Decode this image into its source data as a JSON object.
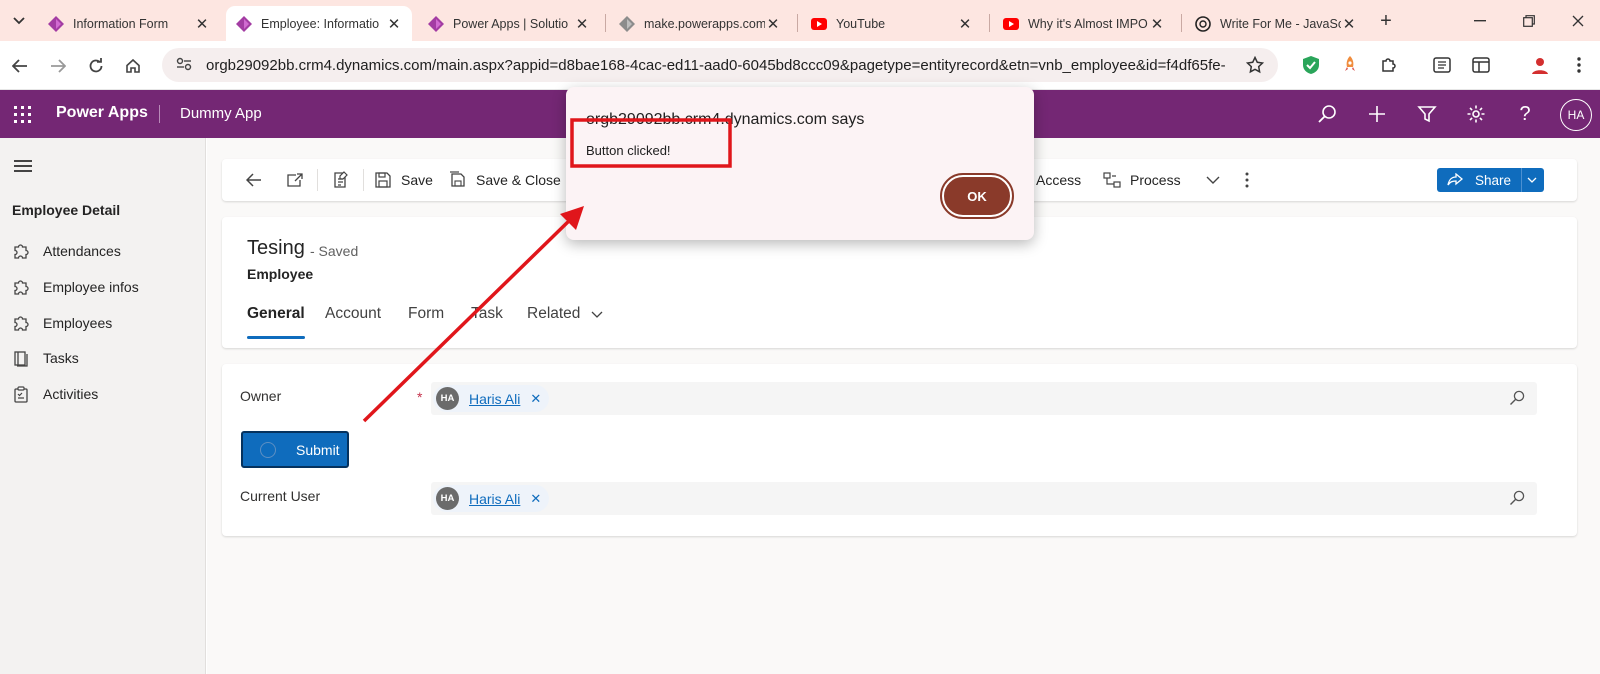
{
  "browser": {
    "tabs": [
      {
        "title": "Information Form",
        "icon": "power-apps-icon",
        "active": false
      },
      {
        "title": "Employee: Informatio",
        "icon": "power-apps-icon",
        "active": true
      },
      {
        "title": "Power Apps | Solutio",
        "icon": "power-apps-icon",
        "active": false
      },
      {
        "title": "make.powerapps.com",
        "icon": "power-apps-gray-icon",
        "active": false
      },
      {
        "title": "YouTube",
        "icon": "youtube-icon",
        "active": false
      },
      {
        "title": "Why it's Almost IMPO",
        "icon": "youtube-icon",
        "active": false
      },
      {
        "title": "Write For Me - JavaSc",
        "icon": "openai-icon",
        "active": false
      }
    ],
    "url": "orgb29092bb.crm4.dynamics.com/main.aspx?appid=d8bae168-4cac-ed11-aad0-6045bd8ccc09&pagetype=entityrecord&etn=vnb_employee&id=f4df65fe-9ef..."
  },
  "app": {
    "brand": "Power Apps",
    "name": "Dummy App",
    "user_initials": "HA"
  },
  "sidebar": {
    "heading": "Employee Detail",
    "items": [
      {
        "label": "Attendances",
        "icon": "puzzle-icon"
      },
      {
        "label": "Employee infos",
        "icon": "puzzle-icon"
      },
      {
        "label": "Employees",
        "icon": "puzzle-icon"
      },
      {
        "label": "Tasks",
        "icon": "task-icon"
      },
      {
        "label": "Activities",
        "icon": "clipboard-icon"
      }
    ]
  },
  "commandbar": {
    "save": "Save",
    "save_close": "Save & Close",
    "access": "Access",
    "process": "Process",
    "share": "Share"
  },
  "record": {
    "title": "Tesing",
    "status": "- Saved",
    "entity": "Employee",
    "tabs": [
      "General",
      "Account",
      "Form",
      "Task",
      "Related"
    ]
  },
  "form": {
    "owner_label": "Owner",
    "owner_required": "*",
    "owner_value": "Haris Ali",
    "owner_initials": "HA",
    "submit_label": "Submit",
    "current_user_label": "Current User",
    "current_user_value": "Haris Ali",
    "current_user_initials": "HA"
  },
  "dialog": {
    "title": "orgb29092bb.crm4.dynamics.com says",
    "message": "Button clicked!",
    "ok": "OK"
  },
  "colors": {
    "app_header": "#742774",
    "accent": "#0f6cbd",
    "annotation": "#e0161b",
    "dialog_ok": "#8a3a2a"
  }
}
